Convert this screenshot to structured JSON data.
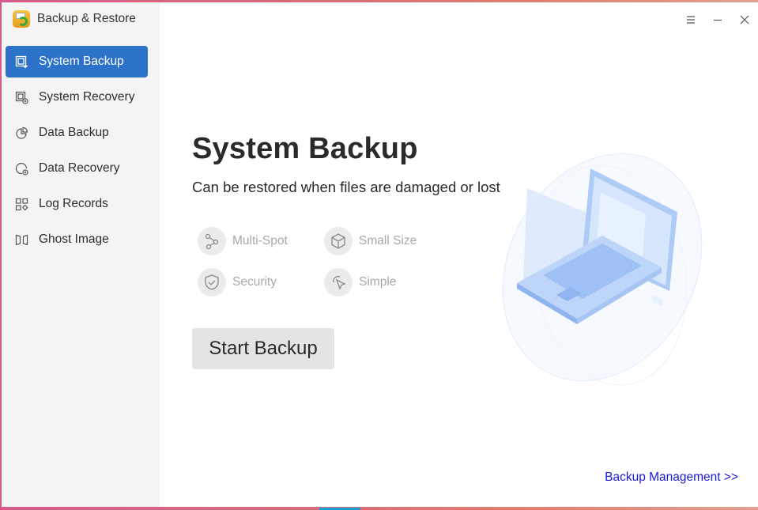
{
  "app": {
    "title": "Backup & Restore",
    "logo_icon": "backup-restore-logo"
  },
  "window_controls": [
    {
      "name": "menu",
      "icon": "hamburger-menu-icon"
    },
    {
      "name": "minimize",
      "icon": "minimize-icon"
    },
    {
      "name": "close",
      "icon": "close-icon"
    }
  ],
  "sidebar": {
    "items": [
      {
        "label": "System Backup",
        "icon": "system-backup-icon",
        "active": true
      },
      {
        "label": "System Recovery",
        "icon": "system-recovery-icon",
        "active": false
      },
      {
        "label": "Data Backup",
        "icon": "data-backup-icon",
        "active": false
      },
      {
        "label": "Data Recovery",
        "icon": "data-recovery-icon",
        "active": false
      },
      {
        "label": "Log Records",
        "icon": "log-records-icon",
        "active": false
      },
      {
        "label": "Ghost Image",
        "icon": "ghost-image-icon",
        "active": false
      }
    ]
  },
  "main": {
    "title": "System Backup",
    "subtitle": "Can be restored when files are damaged or lost",
    "features": [
      {
        "label": "Multi-Spot",
        "icon": "share-nodes-icon"
      },
      {
        "label": "Small Size",
        "icon": "cube-icon"
      },
      {
        "label": "Security",
        "icon": "shield-check-icon"
      },
      {
        "label": "Simple",
        "icon": "cursor-pointer-icon"
      }
    ],
    "start_button": "Start Backup",
    "management_link": "Backup Management >>"
  },
  "colors": {
    "accent": "#2c72c9",
    "link": "#1a1adf",
    "sidebar_bg": "#f4f4f4",
    "feature_text": "#a8a8a8"
  }
}
